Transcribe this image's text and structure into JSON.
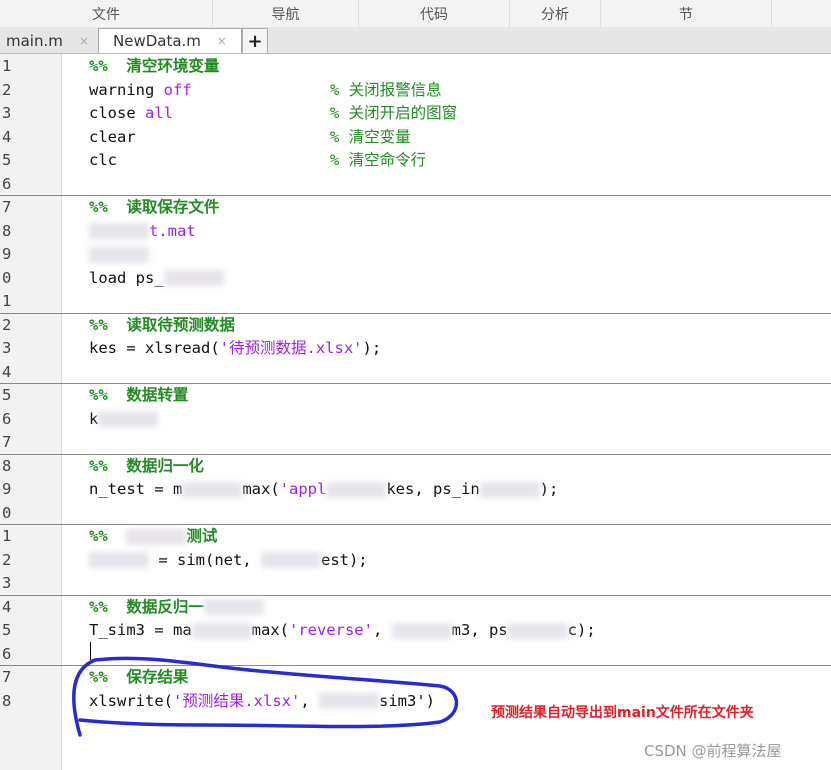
{
  "ribbon": {
    "sections": [
      "文件",
      "导航",
      "代码",
      "分析",
      "节"
    ]
  },
  "tabs": [
    {
      "label": "main.m",
      "close": "×",
      "active": false
    },
    {
      "label": "NewData.m",
      "close": "×",
      "active": true
    }
  ],
  "new_tab_label": "+",
  "lines": [
    {
      "n": "1",
      "seg": [
        {
          "t": "%%  清空环境变量",
          "c": "sec"
        }
      ]
    },
    {
      "n": "2",
      "seg": [
        {
          "t": "warning "
        },
        {
          "t": "off",
          "c": "str"
        }
      ],
      "cmt": "% 关闭报警信息"
    },
    {
      "n": "3",
      "seg": [
        {
          "t": "close "
        },
        {
          "t": "all",
          "c": "str"
        }
      ],
      "cmt": "% 关闭开启的图窗"
    },
    {
      "n": "4",
      "seg": [
        {
          "t": "clear"
        }
      ],
      "cmt": "% 清空变量"
    },
    {
      "n": "5",
      "seg": [
        {
          "t": "clc"
        }
      ],
      "cmt": "% 清空命令行"
    },
    {
      "n": "6",
      "seg": []
    },
    {
      "n": "7",
      "seg": [
        {
          "t": "%%  读取保存文件",
          "c": "sec"
        }
      ]
    },
    {
      "n": "8",
      "seg": [
        {
          "t": "",
          "c": "blur"
        },
        {
          "t": "t.mat",
          "c": "str"
        }
      ]
    },
    {
      "n": "9",
      "seg": [
        {
          "t": "",
          "c": "blur"
        }
      ]
    },
    {
      "n": "0",
      "seg": [
        {
          "t": "load ps_"
        },
        {
          "t": "",
          "c": "blur"
        }
      ]
    },
    {
      "n": "1",
      "seg": []
    },
    {
      "n": "2",
      "seg": [
        {
          "t": "%%  读取待预测数据",
          "c": "sec"
        }
      ]
    },
    {
      "n": "3",
      "seg": [
        {
          "t": "kes = xlsread("
        },
        {
          "t": "'待预测数据.xlsx'",
          "c": "str"
        },
        {
          "t": ");"
        }
      ]
    },
    {
      "n": "4",
      "seg": []
    },
    {
      "n": "5",
      "seg": [
        {
          "t": "%%  数据转置",
          "c": "sec"
        }
      ]
    },
    {
      "n": "6",
      "seg": [
        {
          "t": "k"
        },
        {
          "t": "",
          "c": "blur"
        }
      ]
    },
    {
      "n": "7",
      "seg": []
    },
    {
      "n": "8",
      "seg": [
        {
          "t": "%%  数据归一化",
          "c": "sec"
        }
      ]
    },
    {
      "n": "9",
      "seg": [
        {
          "t": "n_test = m"
        },
        {
          "t": "",
          "c": "blur"
        },
        {
          "t": "max("
        },
        {
          "t": "'appl",
          "c": "str"
        },
        {
          "t": "",
          "c": "blur"
        },
        {
          "t": "kes, ps_in"
        },
        {
          "t": "",
          "c": "blur"
        },
        {
          "t": ");"
        }
      ]
    },
    {
      "n": "0",
      "seg": []
    },
    {
      "n": "1",
      "seg": [
        {
          "t": "%%  ",
          "c": "sec"
        },
        {
          "t": "",
          "c": "blur"
        },
        {
          "t": "测试",
          "c": "sec"
        }
      ]
    },
    {
      "n": "2",
      "seg": [
        {
          "t": "",
          "c": "blur"
        },
        {
          "t": " = sim(net, "
        },
        {
          "t": "",
          "c": "blur"
        },
        {
          "t": "est);"
        }
      ]
    },
    {
      "n": "3",
      "seg": []
    },
    {
      "n": "4",
      "seg": [
        {
          "t": "%%  数据反归一",
          "c": "sec"
        },
        {
          "t": "",
          "c": "blur"
        }
      ]
    },
    {
      "n": "5",
      "seg": [
        {
          "t": "T_sim3 = ma"
        },
        {
          "t": "",
          "c": "blur"
        },
        {
          "t": "max("
        },
        {
          "t": "'reverse'",
          "c": "str"
        },
        {
          "t": ", "
        },
        {
          "t": "",
          "c": "blur"
        },
        {
          "t": "m3, ps"
        },
        {
          "t": "",
          "c": "blur"
        },
        {
          "t": "c);"
        }
      ]
    },
    {
      "n": "6",
      "seg": []
    },
    {
      "n": "7",
      "seg": [
        {
          "t": "%%  保存结果",
          "c": "sec"
        }
      ]
    },
    {
      "n": "8",
      "seg": [
        {
          "t": "xlswrite("
        },
        {
          "t": "'预测结果.xlsx'",
          "c": "str"
        },
        {
          "t": ", "
        },
        {
          "t": "",
          "c": "blur"
        },
        {
          "t": "sim3'"
        },
        {
          "t": ")"
        }
      ]
    }
  ],
  "annotation": "预测结果自动导出到main文件所在文件夹",
  "watermark": "CSDN @前程算法屋",
  "colors": {
    "comment": "#228b22",
    "string": "#a020f0",
    "keyword": "#0000ff",
    "annotation": "#e0202a",
    "circle": "#2a2ad0"
  }
}
